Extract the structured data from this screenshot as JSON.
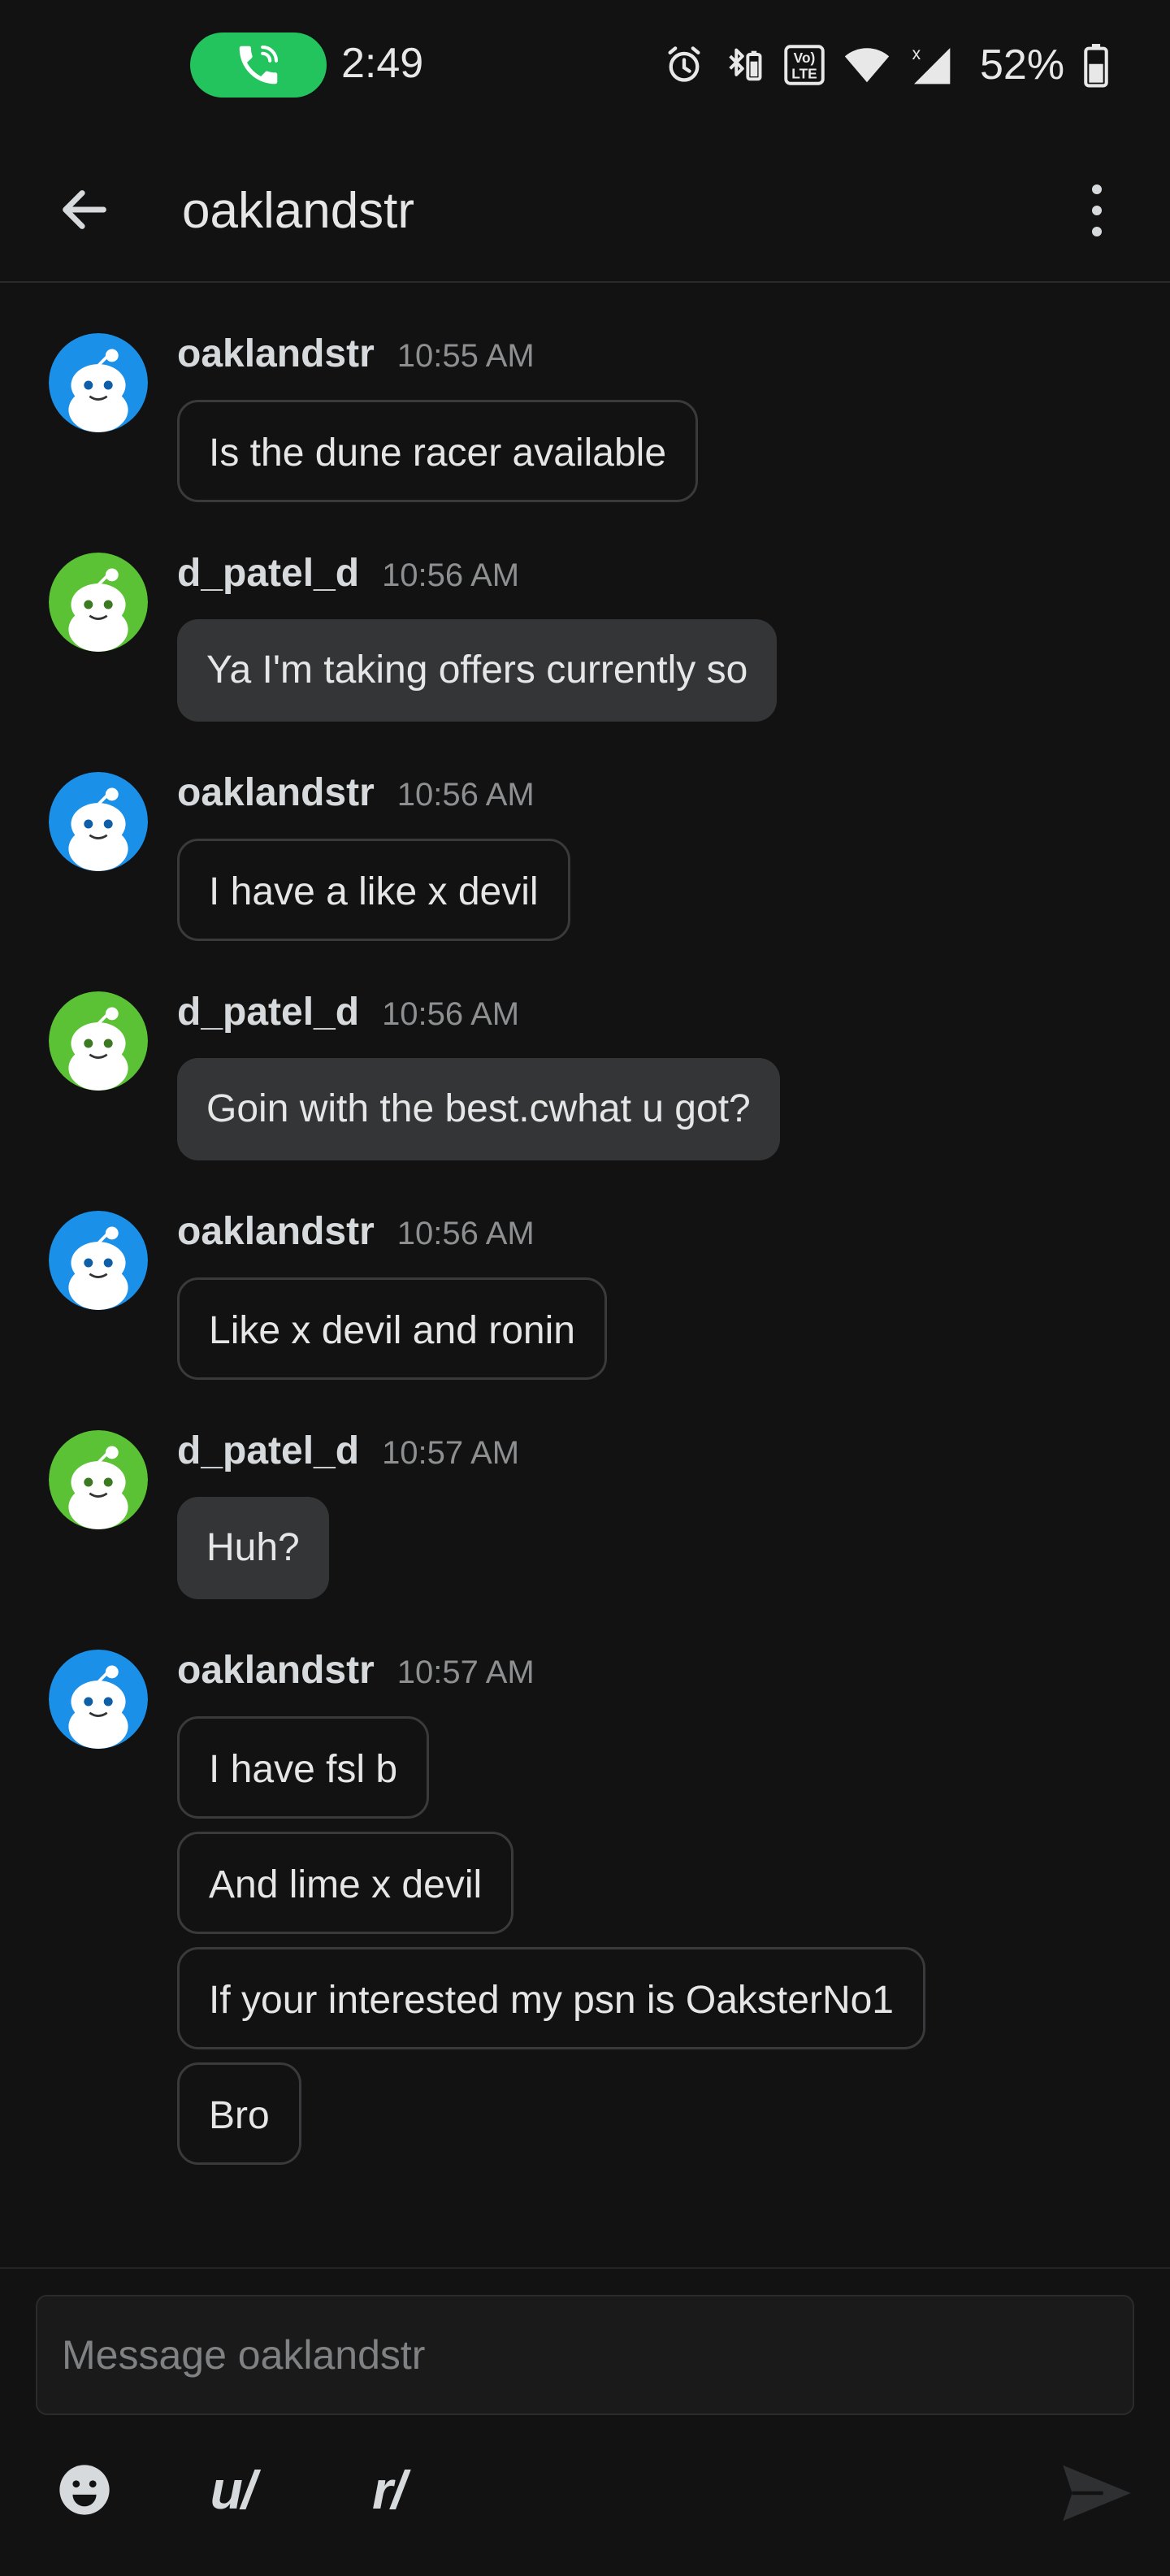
{
  "status_bar": {
    "time": "2:49",
    "battery": "52%",
    "icons": [
      "phone-call-icon",
      "alarm-icon",
      "bluetooth-battery-icon",
      "volte-icon",
      "wifi-icon",
      "signal-icon",
      "battery-icon"
    ],
    "call_color": "#23c45e",
    "volte_label_top": "Vo)",
    "volte_label_bottom": "LTE"
  },
  "header": {
    "title": "oaklandstr",
    "back_icon": "arrow-left-icon",
    "more_icon": "kebab-menu-icon"
  },
  "messages": [
    {
      "author": "oaklandstr",
      "time": "10:55 AM",
      "avatar": "blue",
      "style": "outline",
      "texts": [
        "Is the dune racer available"
      ]
    },
    {
      "author": "d_patel_d",
      "time": "10:56 AM",
      "avatar": "green",
      "style": "filled",
      "texts": [
        "Ya I'm taking offers currently so"
      ]
    },
    {
      "author": "oaklandstr",
      "time": "10:56 AM",
      "avatar": "blue",
      "style": "outline",
      "texts": [
        "I have a like x devil"
      ]
    },
    {
      "author": "d_patel_d",
      "time": "10:56 AM",
      "avatar": "green",
      "style": "filled",
      "texts": [
        "Goin with the best.cwhat u got?"
      ]
    },
    {
      "author": "oaklandstr",
      "time": "10:56 AM",
      "avatar": "blue",
      "style": "outline",
      "texts": [
        "Like x devil and ronin"
      ]
    },
    {
      "author": "d_patel_d",
      "time": "10:57 AM",
      "avatar": "green",
      "style": "filled",
      "texts": [
        "Huh?"
      ]
    },
    {
      "author": "oaklandstr",
      "time": "10:57 AM",
      "avatar": "blue",
      "style": "outline",
      "texts": [
        "I have fsl b",
        "And lime x devil",
        "If your interested my psn is OaksterNo1",
        "Bro"
      ]
    }
  ],
  "composer": {
    "placeholder": "Message oaklandstr",
    "user_label": "u/",
    "subreddit_label": "r/",
    "emoji_icon": "emoji-icon",
    "send_icon": "send-icon"
  },
  "colors": {
    "background": "#121212",
    "avatar_blue": "#1a90e8",
    "avatar_green": "#5bc236",
    "filled_bubble": "#343536",
    "outline_border": "#3a3a3c"
  }
}
